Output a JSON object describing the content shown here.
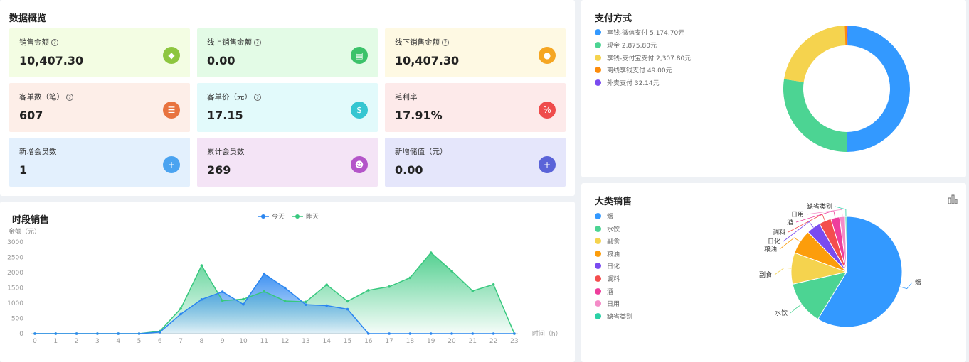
{
  "overview": {
    "title": "数据概览",
    "cards": [
      {
        "label": "销售金额",
        "value": "10,407.30",
        "help": true,
        "bg": "#f3fde3",
        "icon_color": "#8dc63f",
        "icon": "tag-icon",
        "glyph": "◆"
      },
      {
        "label": "线上销售金额",
        "value": "0.00",
        "help": true,
        "bg": "#e3fbe6",
        "icon_color": "#3cc26a",
        "icon": "wallet-icon",
        "glyph": "▤"
      },
      {
        "label": "线下销售金额",
        "value": "10,407.30",
        "help": true,
        "bg": "#fef9e3",
        "icon_color": "#f5a623",
        "icon": "planet-icon",
        "glyph": "●"
      },
      {
        "label": "客单数（笔）",
        "value": "607",
        "help": true,
        "bg": "#fdeee8",
        "icon_color": "#e8733f",
        "icon": "stack-icon",
        "glyph": "☰"
      },
      {
        "label": "客单价（元）",
        "value": "17.15",
        "help": true,
        "bg": "#e2fafb",
        "icon_color": "#35c6d1",
        "icon": "money-bag-icon",
        "glyph": "$"
      },
      {
        "label": "毛利率",
        "value": "17.91%",
        "help": false,
        "bg": "#fdeaea",
        "icon_color": "#ef4c4c",
        "icon": "percent-icon",
        "glyph": "%"
      },
      {
        "label": "新增会员数",
        "value": "1",
        "help": false,
        "bg": "#e3f0fd",
        "icon_color": "#4aa3f0",
        "icon": "user-add-icon",
        "glyph": "+"
      },
      {
        "label": "累计会员数",
        "value": "269",
        "help": false,
        "bg": "#f4e4f6",
        "icon_color": "#b455c9",
        "icon": "users-icon",
        "glyph": "☻"
      },
      {
        "label": "新增储值（元）",
        "value": "0.00",
        "help": false,
        "bg": "#e5e6fb",
        "icon_color": "#5a63d8",
        "icon": "stored-value-icon",
        "glyph": "+"
      }
    ]
  },
  "payment": {
    "title": "支付方式",
    "legend": [
      {
        "label": "享钱-微信支付 5,174.70元",
        "color": "#3399ff"
      },
      {
        "label": "现金 2,875.80元",
        "color": "#4cd493"
      },
      {
        "label": "享钱-支付宝支付 2,307.80元",
        "color": "#f5d34e"
      },
      {
        "label": "离线享钱支付 49.00元",
        "color": "#fc8c0b"
      },
      {
        "label": "外卖支付 32.14元",
        "color": "#7a4bf0"
      }
    ],
    "chart_data": {
      "type": "pie",
      "categories": [
        "享钱-微信支付",
        "现金",
        "享钱-支付宝支付",
        "离线享钱支付",
        "外卖支付"
      ],
      "values": [
        5174.7,
        2875.8,
        2307.8,
        49.0,
        32.14
      ],
      "colors": [
        "#3399ff",
        "#4cd493",
        "#f5d34e",
        "#fc8c0b",
        "#7a4bf0"
      ]
    }
  },
  "hourly": {
    "title": "时段销售",
    "ylabel": "金额（元）",
    "xlabel": "时间（h）",
    "chart_data": {
      "type": "area",
      "x": [
        0,
        1,
        2,
        3,
        4,
        5,
        6,
        7,
        8,
        9,
        10,
        11,
        12,
        13,
        14,
        15,
        16,
        17,
        18,
        19,
        20,
        21,
        22,
        23
      ],
      "ylim": [
        0,
        3000
      ],
      "yticks": [
        0,
        500,
        1000,
        1500,
        2000,
        2500,
        3000
      ],
      "series": [
        {
          "name": "今天",
          "color": "#2b86f0",
          "values": [
            0,
            0,
            0,
            0,
            0,
            0,
            50,
            640,
            1120,
            1370,
            960,
            1960,
            1500,
            950,
            920,
            800,
            0,
            0,
            0,
            0,
            0,
            0,
            0,
            0
          ]
        },
        {
          "name": "昨天",
          "color": "#37c87e",
          "values": [
            0,
            0,
            0,
            0,
            0,
            0,
            80,
            820,
            2230,
            1080,
            1130,
            1380,
            1070,
            1040,
            1600,
            1060,
            1420,
            1540,
            1830,
            2650,
            2050,
            1400,
            1610,
            0
          ]
        }
      ]
    }
  },
  "category": {
    "title": "大类销售",
    "legend": [
      {
        "label": "烟",
        "color": "#3399ff"
      },
      {
        "label": "水饮",
        "color": "#4cd493"
      },
      {
        "label": "副食",
        "color": "#f5d34e"
      },
      {
        "label": "粮油",
        "color": "#fc9d0b"
      },
      {
        "label": "日化",
        "color": "#7a4bf0"
      },
      {
        "label": "调料",
        "color": "#f44e4e"
      },
      {
        "label": "酒",
        "color": "#ee3e9c"
      },
      {
        "label": "日用",
        "color": "#f48cc8"
      },
      {
        "label": "缺省类别",
        "color": "#2bd1a6"
      }
    ],
    "chart_data": {
      "type": "pie",
      "categories": [
        "烟",
        "水饮",
        "副食",
        "粮油",
        "日化",
        "调料",
        "酒",
        "日用",
        "缺省类别"
      ],
      "values": [
        57.5,
        12.5,
        9.0,
        7.0,
        4.0,
        3.5,
        2.5,
        1.6,
        0.4
      ],
      "colors": [
        "#3399ff",
        "#4cd493",
        "#f5d34e",
        "#fc9d0b",
        "#7a4bf0",
        "#f44e4e",
        "#ee3e9c",
        "#f48cc8",
        "#2bd1a6"
      ]
    }
  }
}
